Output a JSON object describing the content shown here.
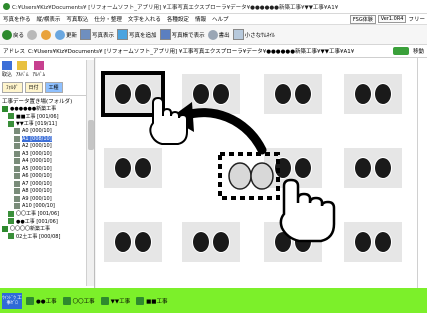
{
  "window": {
    "title": "C:¥Users¥Kiz¥Documents¥ [リフォームソフト_アプリ用] ¥工事写真エクスプローラ¥データ¥●●●●●●新築工事¥▼▼工事¥A1¥"
  },
  "menu": {
    "items": [
      "写真を作る",
      "縦/横表示",
      "写真取込",
      "仕分・整理",
      "文字を入れる",
      "各種設定",
      "情報",
      "ヘルプ"
    ],
    "right_pill_1": "FSG体験",
    "right_pill_2": "Ver1.0R4",
    "right_free": "フリー"
  },
  "toolbar": {
    "buttons": [
      "戻る",
      "",
      "",
      "更新",
      "写真表示",
      "写真を追加",
      "写真帳で表示",
      "",
      "書出",
      "",
      "小さなｻﾑﾈｲﾙ"
    ]
  },
  "address": {
    "label": "アドレス",
    "path": "C:¥Users¥Kiz¥Documents¥ [リフォームソフト_アプリ用] ¥工事写真エクスプローラ¥データ¥●●●●●●新築工事¥▼▼工事¥A1¥",
    "go_label": "移動"
  },
  "left": {
    "top_buttons": [
      "取込",
      "ｱﾙﾊﾞﾑ",
      "ｱﾙﾊﾞﾑ"
    ],
    "tabs": [
      "ﾌｫﾙﾀﾞ",
      "日付",
      "工種"
    ],
    "header": "工事データ置き場(フォルダ)",
    "tree": [
      {
        "label": "●●●●●●新築工事",
        "indent": 0
      },
      {
        "label": "■■工事 [001/06]",
        "indent": 1
      },
      {
        "label": "▼▼工事 [019/11]",
        "indent": 1
      },
      {
        "label": "A0 [000/10]",
        "indent": 2
      },
      {
        "label": "A1 [008/10]",
        "indent": 2,
        "selected": true
      },
      {
        "label": "A2 [000/10]",
        "indent": 2
      },
      {
        "label": "A3 [000/10]",
        "indent": 2
      },
      {
        "label": "A4 [000/10]",
        "indent": 2
      },
      {
        "label": "A5 [000/10]",
        "indent": 2
      },
      {
        "label": "A6 [000/10]",
        "indent": 2
      },
      {
        "label": "A7 [000/10]",
        "indent": 2
      },
      {
        "label": "A8 [000/10]",
        "indent": 2
      },
      {
        "label": "A9 [000/10]",
        "indent": 2
      },
      {
        "label": "A10 [000/10]",
        "indent": 2
      },
      {
        "label": "〇〇工事 [001/06]",
        "indent": 1
      },
      {
        "label": "●●工事 [001/06]",
        "indent": 1
      },
      {
        "label": "〇〇〇〇新築工事",
        "indent": 0
      },
      {
        "label": "02土工事 [000/08]",
        "indent": 1
      }
    ]
  },
  "statusbar": {
    "start_label": "ｳｲﾝﾄﾞｳ 工事ｾﾞﾛ",
    "tabs": [
      "●●工事",
      "〇〇工事",
      "▼▼工事",
      "■■工事"
    ]
  },
  "gallery": {
    "thumbs": 12
  },
  "colors": {
    "accent": "#7cf02a",
    "selection": "#3d6fd8",
    "thumb_bg": "#e6e6e6"
  }
}
